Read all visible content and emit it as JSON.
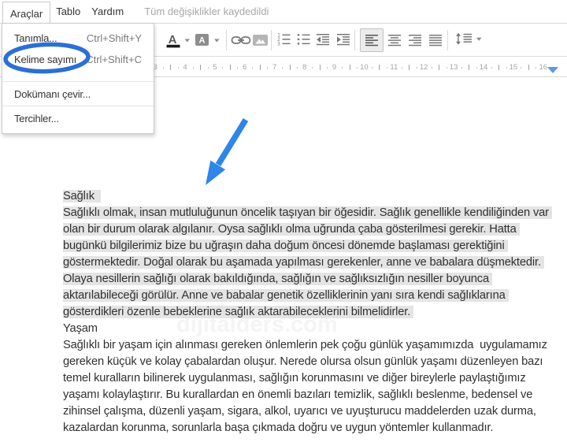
{
  "menu_bar": {
    "items": [
      {
        "id": "araclar",
        "label": "Araçlar",
        "open": true
      },
      {
        "id": "tablo",
        "label": "Tablo",
        "open": false
      },
      {
        "id": "yardim",
        "label": "Yardım",
        "open": false
      }
    ],
    "status_text": "Tüm değişiklikler kaydedildi"
  },
  "tools_menu": {
    "items": [
      {
        "id": "tanimla",
        "label": "Tanımla...",
        "shortcut": "Ctrl+Shift+Y"
      },
      {
        "id": "kelime-sayimi",
        "label": "Kelime sayımı",
        "shortcut": "Ctrl+Shift+C",
        "circled": true
      },
      {
        "type": "separator"
      },
      {
        "id": "dokumani-cevir",
        "label": "Dokümanı çevir..."
      },
      {
        "type": "separator"
      },
      {
        "id": "tercihler",
        "label": "Tercihler..."
      }
    ]
  },
  "toolbar": {
    "tools": [
      "text-color",
      "highlight-color",
      "insert-link",
      "insert-image",
      "numbered-list",
      "bulleted-list",
      "decrease-indent",
      "increase-indent",
      "align-left",
      "align-center",
      "align-right",
      "justify-full",
      "line-spacing"
    ],
    "active_tool": "align-left"
  },
  "ruler": {
    "numbers": [
      3,
      4,
      5,
      6,
      7,
      8,
      9,
      10,
      11,
      12,
      13,
      14,
      15,
      16
    ]
  },
  "document": {
    "sections": [
      {
        "heading": "Sağlık",
        "selected": true,
        "lines": [
          "Sağlıklı olmak, insan mutluluğunun öncelik taşıyan bir öğesidir. Sağlık genellikle kendiliğinden var",
          "olan bir durum olarak algılanır. Oysa sağlıklı olma uğrunda çaba gösterilmesi gerekir. Hatta",
          "bugünkü bilgilerimiz bize bu uğraşın daha doğum öncesi dönemde başlaması gerektiğini",
          "göstermektedir. Doğal olarak bu aşamada yapılması gerekenler, anne ve babalara düşmektedir.",
          "Olaya nesillerin sağlığı olarak bakıldığında, sağlığın ve sağlıksızlığın nesiller boyunca",
          "aktarılabileceği görülür. Anne ve babalar genetik özelliklerinin yanı sıra kendi sağlıklarına",
          "gösterdikleri özenle bebeklerine sağlık aktarabileceklerini bilmelidirler."
        ]
      },
      {
        "heading": "Yaşam",
        "selected": false,
        "lines": [
          "Sağlıklı bir yaşam için alınması gereken önlemlerin pek çoğu günlük yaşamımızda  uygulamamız",
          "gereken küçük ve kolay çabalardan oluşur. Nerede olursa olsun günlük yaşamı düzenleyen bazı",
          "temel kuralların bilinerek uygulanması, sağlığın korunmasını ve diğer bireylerle paylaştığımız",
          "yaşamı kolaylaştırır. Bu kurallardan en önemli bazıları temizlik, sağlıklı beslenme, bedensel ve",
          "zihinsel çalışma, düzenli yaşam, sigara, alkol, uyarıcı ve uyuşturucu maddelerden uzak durma,",
          "kazalardan korunma, sorunlarla başa çıkmada doğru ve uygun yöntemler kullanmadır."
        ]
      }
    ]
  },
  "watermark": {
    "text": "dijitalders.com"
  },
  "annotations": {
    "arrow_color": "#2e86e8",
    "circle_color": "#2c6fd6"
  }
}
